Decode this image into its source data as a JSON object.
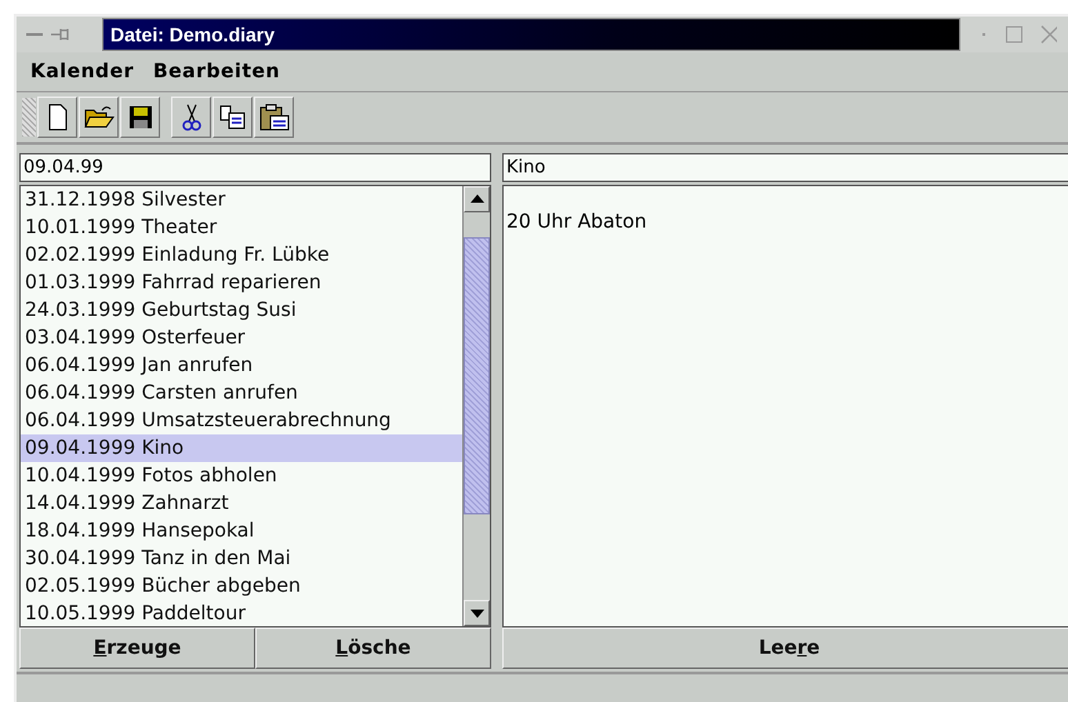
{
  "window": {
    "title": "Datei: Demo.diary"
  },
  "menu": [
    "Kalender",
    "Bearbeiten"
  ],
  "toolbar": [
    {
      "kind": "new"
    },
    {
      "kind": "open"
    },
    {
      "kind": "save"
    },
    {
      "kind": "cut"
    },
    {
      "kind": "copy"
    },
    {
      "kind": "paste"
    }
  ],
  "date_field": {
    "value": "09.04.99"
  },
  "entries": [
    {
      "text": "31.12.1998 Silvester",
      "selected": false
    },
    {
      "text": "10.01.1999 Theater",
      "selected": false
    },
    {
      "text": "02.02.1999 Einladung Fr. Lübke",
      "selected": false
    },
    {
      "text": "01.03.1999 Fahrrad reparieren",
      "selected": false
    },
    {
      "text": "24.03.1999 Geburtstag Susi",
      "selected": false
    },
    {
      "text": "03.04.1999 Osterfeuer",
      "selected": false
    },
    {
      "text": "06.04.1999 Jan anrufen",
      "selected": false
    },
    {
      "text": "06.04.1999 Carsten anrufen",
      "selected": false
    },
    {
      "text": "06.04.1999 Umsatzsteuerabrechnung",
      "selected": false
    },
    {
      "text": "09.04.1999 Kino",
      "selected": true
    },
    {
      "text": "10.04.1999 Fotos abholen",
      "selected": false
    },
    {
      "text": "14.04.1999 Zahnarzt",
      "selected": false
    },
    {
      "text": "18.04.1999 Hansepokal",
      "selected": false
    },
    {
      "text": "30.04.1999 Tanz in den Mai",
      "selected": false
    },
    {
      "text": "02.05.1999 Bücher abgeben",
      "selected": false
    },
    {
      "text": "10.05.1999 Paddeltour",
      "selected": false
    }
  ],
  "title_field": {
    "value": "Kino"
  },
  "note": {
    "value": "20 Uhr Abaton"
  },
  "left_buttons": [
    {
      "key": "E",
      "post": "rzeuge"
    },
    {
      "key": "L",
      "post": "ösche"
    }
  ],
  "right_button": {
    "pre": "Lee",
    "key": "r",
    "post": "e"
  }
}
